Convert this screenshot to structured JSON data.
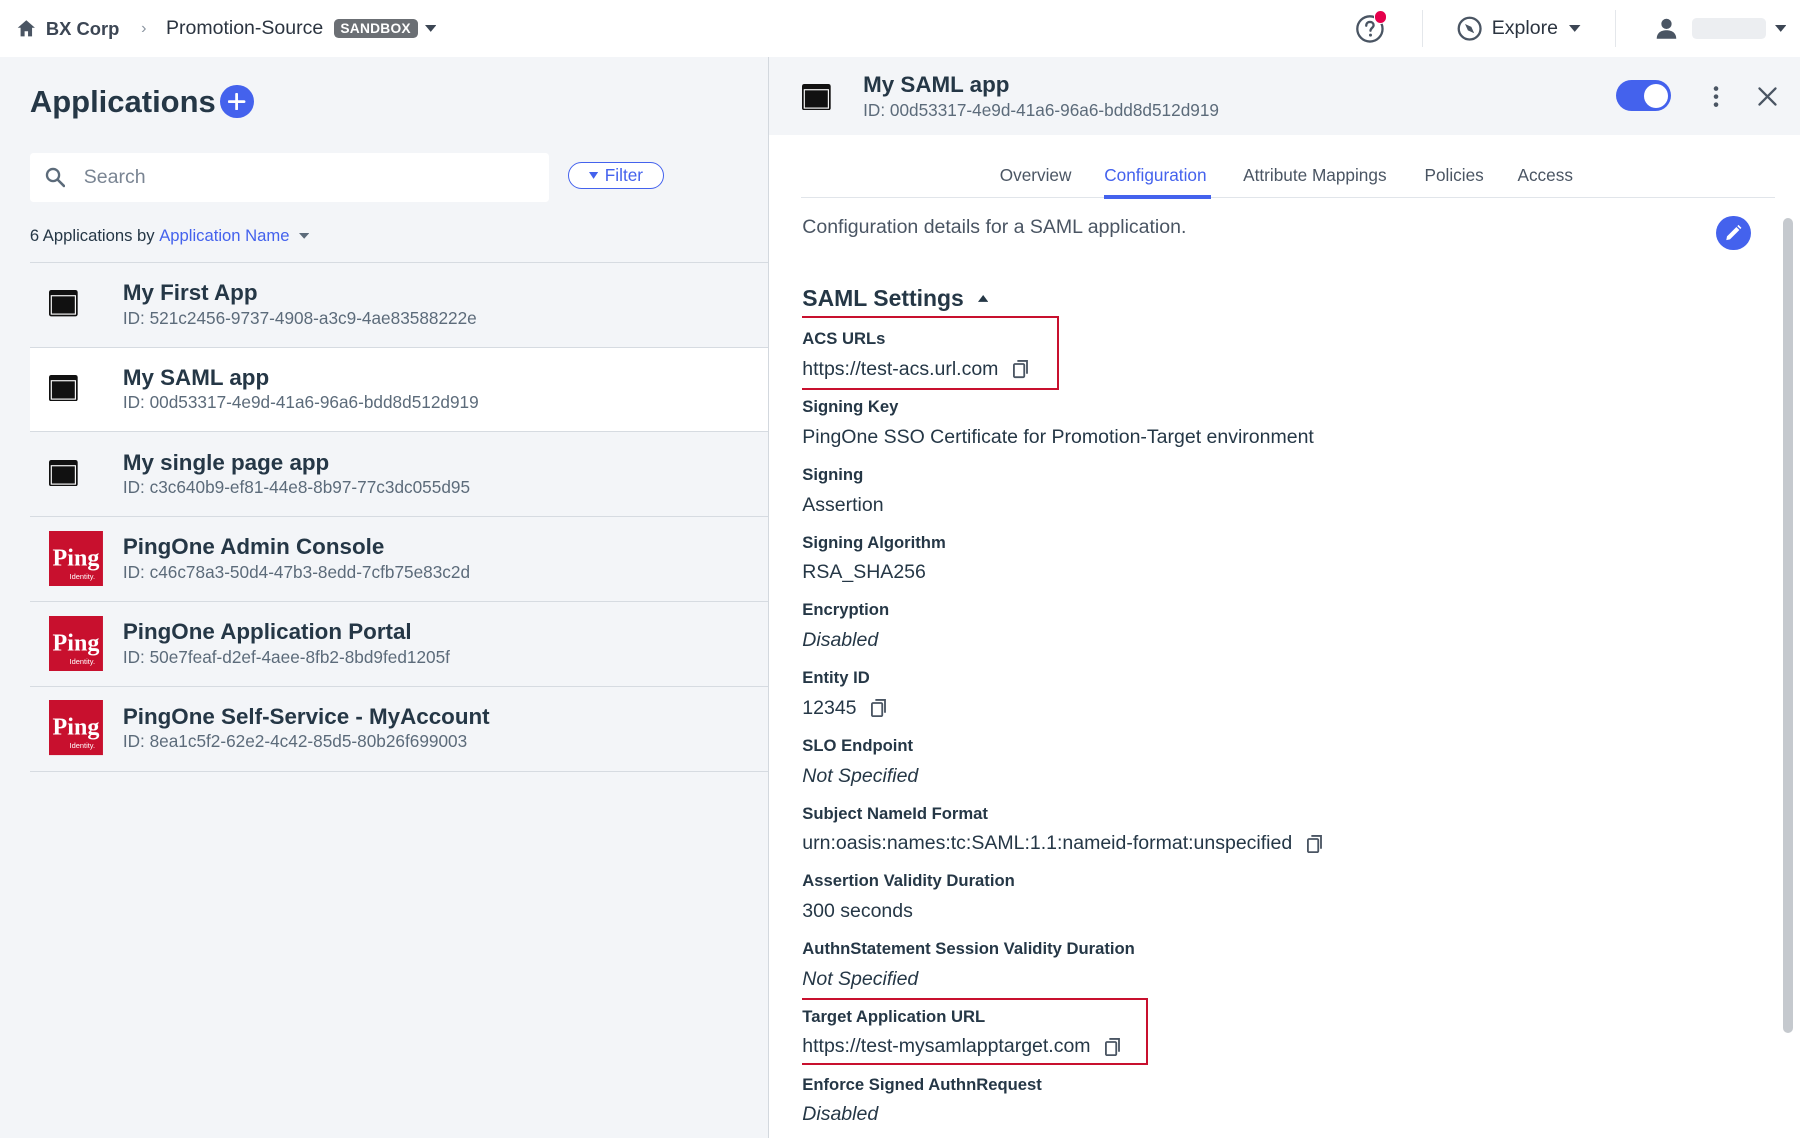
{
  "topbar": {
    "org": "BX Corp",
    "environment": "Promotion-Source",
    "env_badge": "SANDBOX",
    "explore_label": "Explore"
  },
  "applications": {
    "title": "Applications",
    "search_placeholder": "Search",
    "filter_label": "Filter",
    "count_text": "6 Applications by",
    "sort_by": "Application Name",
    "items": [
      {
        "name": "My First App",
        "id": "ID: 521c2456-9737-4908-a3c9-4ae83588222e",
        "icon": "app-window-icon"
      },
      {
        "name": "My SAML app",
        "id": "ID: 00d53317-4e9d-41a6-96a6-bdd8d512d919",
        "icon": "app-window-icon",
        "selected": true
      },
      {
        "name": "My single page app",
        "id": "ID: c3c640b9-ef81-44e8-8b97-77c3dc055d95",
        "icon": "app-window-icon"
      },
      {
        "name": "PingOne Admin Console",
        "id": "ID: c46c78a3-50d4-47b3-8edd-7cfb75e83c2d",
        "icon": "ping-identity-logo"
      },
      {
        "name": "PingOne Application Portal",
        "id": "ID: 50e7feaf-d2ef-4aee-8fb2-8bd9fed1205f",
        "icon": "ping-identity-logo"
      },
      {
        "name": "PingOne Self-Service - MyAccount",
        "id": "ID: 8ea1c5f2-62e2-4c42-85d5-80b26f699003",
        "icon": "ping-identity-logo"
      }
    ],
    "ping_logo_text": "Ping",
    "ping_logo_subtext": "Identity."
  },
  "detail": {
    "name": "My SAML app",
    "id": "ID: 00d53317-4e9d-41a6-96a6-bdd8d512d919",
    "enabled": true,
    "tabs": [
      "Overview",
      "Configuration",
      "Attribute Mappings",
      "Policies",
      "Access"
    ],
    "active_tab": "Configuration",
    "description": "Configuration details for a SAML application.",
    "section_title": "SAML Settings",
    "fields": [
      {
        "label": "ACS URLs",
        "value": "https://test-acs.url.com",
        "copy": true,
        "italic": false,
        "highlighted": true
      },
      {
        "label": "Signing Key",
        "value": "PingOne SSO Certificate for Promotion-Target environment",
        "copy": false,
        "italic": false
      },
      {
        "label": "Signing",
        "value": "Assertion",
        "copy": false,
        "italic": false
      },
      {
        "label": "Signing Algorithm",
        "value": "RSA_SHA256",
        "copy": false,
        "italic": false
      },
      {
        "label": "Encryption",
        "value": "Disabled",
        "copy": false,
        "italic": true
      },
      {
        "label": "Entity ID",
        "value": "12345",
        "copy": true,
        "italic": false
      },
      {
        "label": "SLO Endpoint",
        "value": "Not Specified",
        "copy": false,
        "italic": true
      },
      {
        "label": "Subject NameId Format",
        "value": "urn:oasis:names:tc:SAML:1.1:nameid-format:unspecified",
        "copy": true,
        "italic": false
      },
      {
        "label": "Assertion Validity Duration",
        "value": "300 seconds",
        "copy": false,
        "italic": false
      },
      {
        "label": "AuthnStatement Session Validity Duration",
        "value": "Not Specified",
        "copy": false,
        "italic": true
      },
      {
        "label": "Target Application URL",
        "value": "https://test-mysamlapptarget.com",
        "copy": true,
        "italic": false,
        "highlighted": true
      },
      {
        "label": "Enforce Signed AuthnRequest",
        "value": "Disabled",
        "copy": false,
        "italic": true
      }
    ]
  },
  "colors": {
    "accent": "#4462ed",
    "highlight_box": "#c8102e",
    "notification_dot": "#e5004c",
    "ping_red": "#c8102e"
  }
}
